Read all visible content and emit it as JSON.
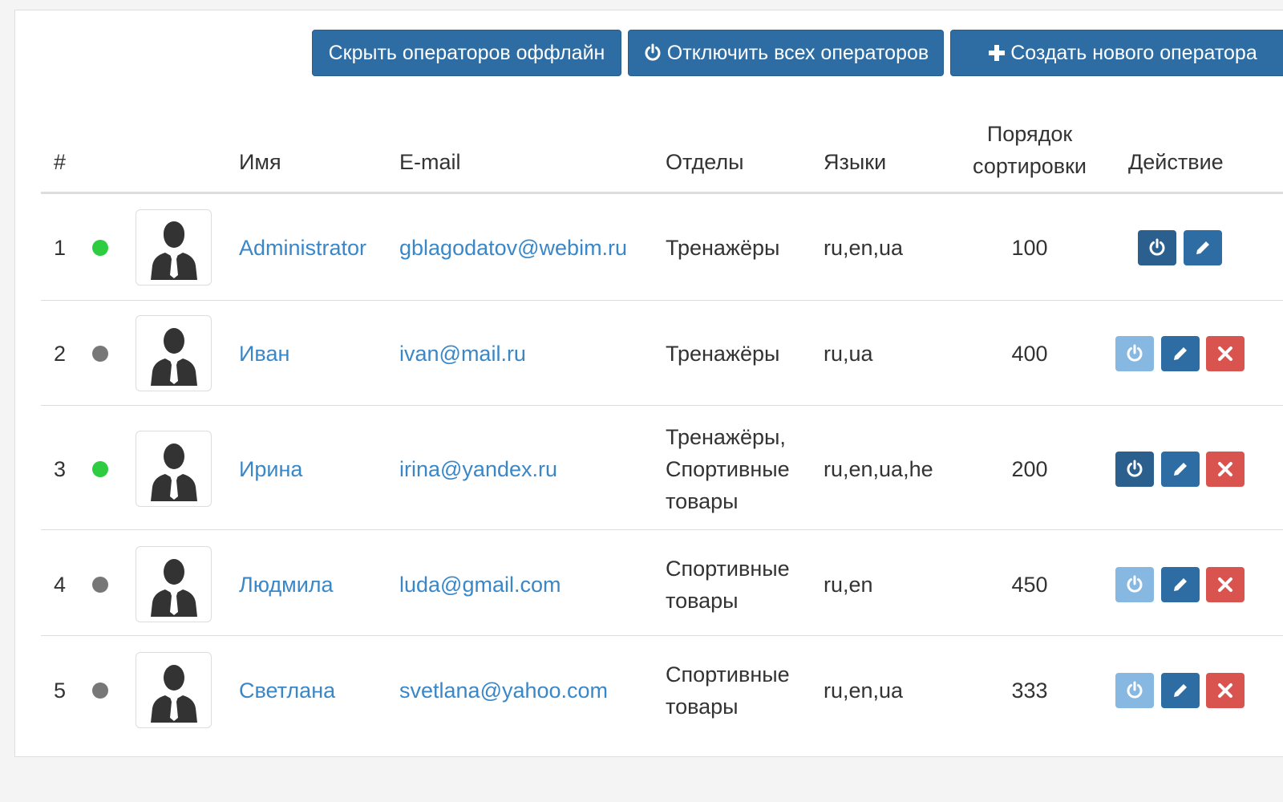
{
  "toolbar": {
    "hide_offline_label": "Скрыть операторов оффлайн",
    "disable_all_label": "Отключить всех операторов",
    "create_new_label": "Создать нового оператора"
  },
  "table": {
    "headers": {
      "num": "#",
      "name": "Имя",
      "email": "E-mail",
      "departments": "Отделы",
      "languages": "Языки",
      "sort_line1": "Порядок",
      "sort_line2": "сортировки",
      "action": "Действие"
    },
    "rows": [
      {
        "num": "1",
        "status": "online",
        "name": "Administrator",
        "email": "gblagodatov@webim.ru",
        "dept1": "Тренажёры",
        "dept2": "",
        "dept3": "",
        "languages": "ru,en,ua",
        "sort": "100"
      },
      {
        "num": "2",
        "status": "offline",
        "name": "Иван",
        "email": "ivan@mail.ru",
        "dept1": "Тренажёры",
        "dept2": "",
        "dept3": "",
        "languages": "ru,ua",
        "sort": "400"
      },
      {
        "num": "3",
        "status": "online",
        "name": "Ирина",
        "email": "irina@yandex.ru",
        "dept1": "Тренажёры,",
        "dept2": "Спортивные",
        "dept3": "товары",
        "languages": "ru,en,ua,he",
        "sort": "200"
      },
      {
        "num": "4",
        "status": "offline",
        "name": "Людмила",
        "email": "luda@gmail.com",
        "dept1": "Спортивные",
        "dept2": "товары",
        "dept3": "",
        "languages": "ru,en",
        "sort": "450"
      },
      {
        "num": "5",
        "status": "offline",
        "name": "Светлана",
        "email": "svetlana@yahoo.com",
        "dept1": "Спортивные",
        "dept2": "товары",
        "dept3": "",
        "languages": "ru,en,ua",
        "sort": "333"
      }
    ]
  },
  "colors": {
    "online": "#2ecc40",
    "offline": "#777777",
    "link": "#3a87c8",
    "primary": "#2e6da4",
    "danger": "#d9534f"
  }
}
